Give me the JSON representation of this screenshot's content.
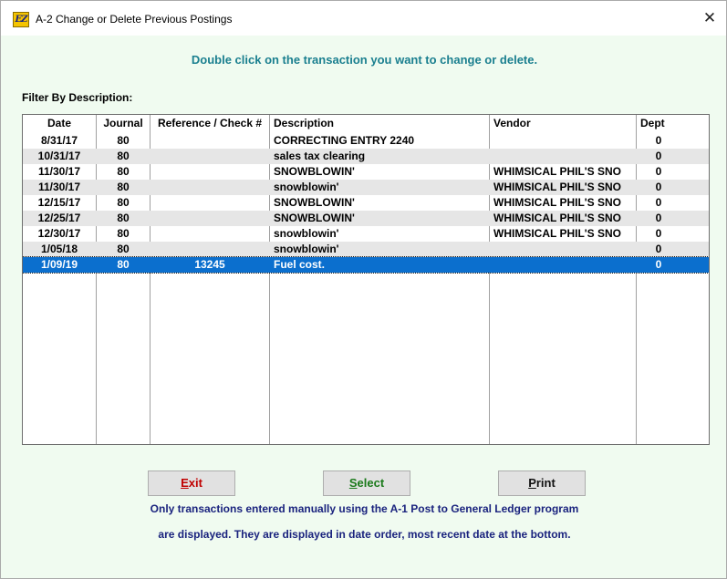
{
  "window": {
    "icon_text": "EZ",
    "title": "A-2  Change or Delete Previous Postings",
    "close_glyph": "✕"
  },
  "instruction": "Double click on the transaction you want to change or delete.",
  "filter_label": "Filter By Description:",
  "columns": {
    "date": "Date",
    "journal": "Journal",
    "reference": "Reference / Check #",
    "description": "Description",
    "vendor": "Vendor",
    "dept": "Dept"
  },
  "rows": [
    {
      "date": "8/31/17",
      "journal": "80",
      "reference": "",
      "description": "CORRECTING ENTRY 2240",
      "vendor": "",
      "dept": "0"
    },
    {
      "date": "10/31/17",
      "journal": "80",
      "reference": "",
      "description": "sales tax clearing",
      "vendor": "",
      "dept": "0"
    },
    {
      "date": "11/30/17",
      "journal": "80",
      "reference": "",
      "description": "SNOWBLOWIN'",
      "vendor": "WHIMSICAL PHIL'S SNO",
      "dept": "0"
    },
    {
      "date": "11/30/17",
      "journal": "80",
      "reference": "",
      "description": "snowblowin'",
      "vendor": "WHIMSICAL PHIL'S SNO",
      "dept": "0"
    },
    {
      "date": "12/15/17",
      "journal": "80",
      "reference": "",
      "description": "SNOWBLOWIN'",
      "vendor": "WHIMSICAL PHIL'S SNO",
      "dept": "0"
    },
    {
      "date": "12/25/17",
      "journal": "80",
      "reference": "",
      "description": "SNOWBLOWIN'",
      "vendor": "WHIMSICAL PHIL'S SNO",
      "dept": "0"
    },
    {
      "date": "12/30/17",
      "journal": "80",
      "reference": "",
      "description": "snowblowin'",
      "vendor": "WHIMSICAL PHIL'S SNO",
      "dept": "0"
    },
    {
      "date": "1/05/18",
      "journal": "80",
      "reference": "",
      "description": "snowblowin'",
      "vendor": "",
      "dept": "0"
    },
    {
      "date": "1/09/19",
      "journal": "80",
      "reference": "13245",
      "description": "Fuel cost.",
      "vendor": "",
      "dept": "0"
    }
  ],
  "selected_row": 8,
  "buttons": {
    "exit": {
      "hotkey": "E",
      "rest": "xit"
    },
    "select": {
      "hotkey": "S",
      "rest": "elect"
    },
    "print": {
      "hotkey": "P",
      "rest": "rint"
    }
  },
  "notes": {
    "line1": "Only transactions entered manually using the A-1 Post to General Ledger program",
    "line2": "are displayed.  They are displayed in date order, most recent date at the bottom."
  },
  "colors": {
    "instruction": "#1a7f8f",
    "selection": "#0b6fce",
    "exit": "#c00000",
    "select": "#1b7a1b",
    "notes": "#1a237e"
  }
}
